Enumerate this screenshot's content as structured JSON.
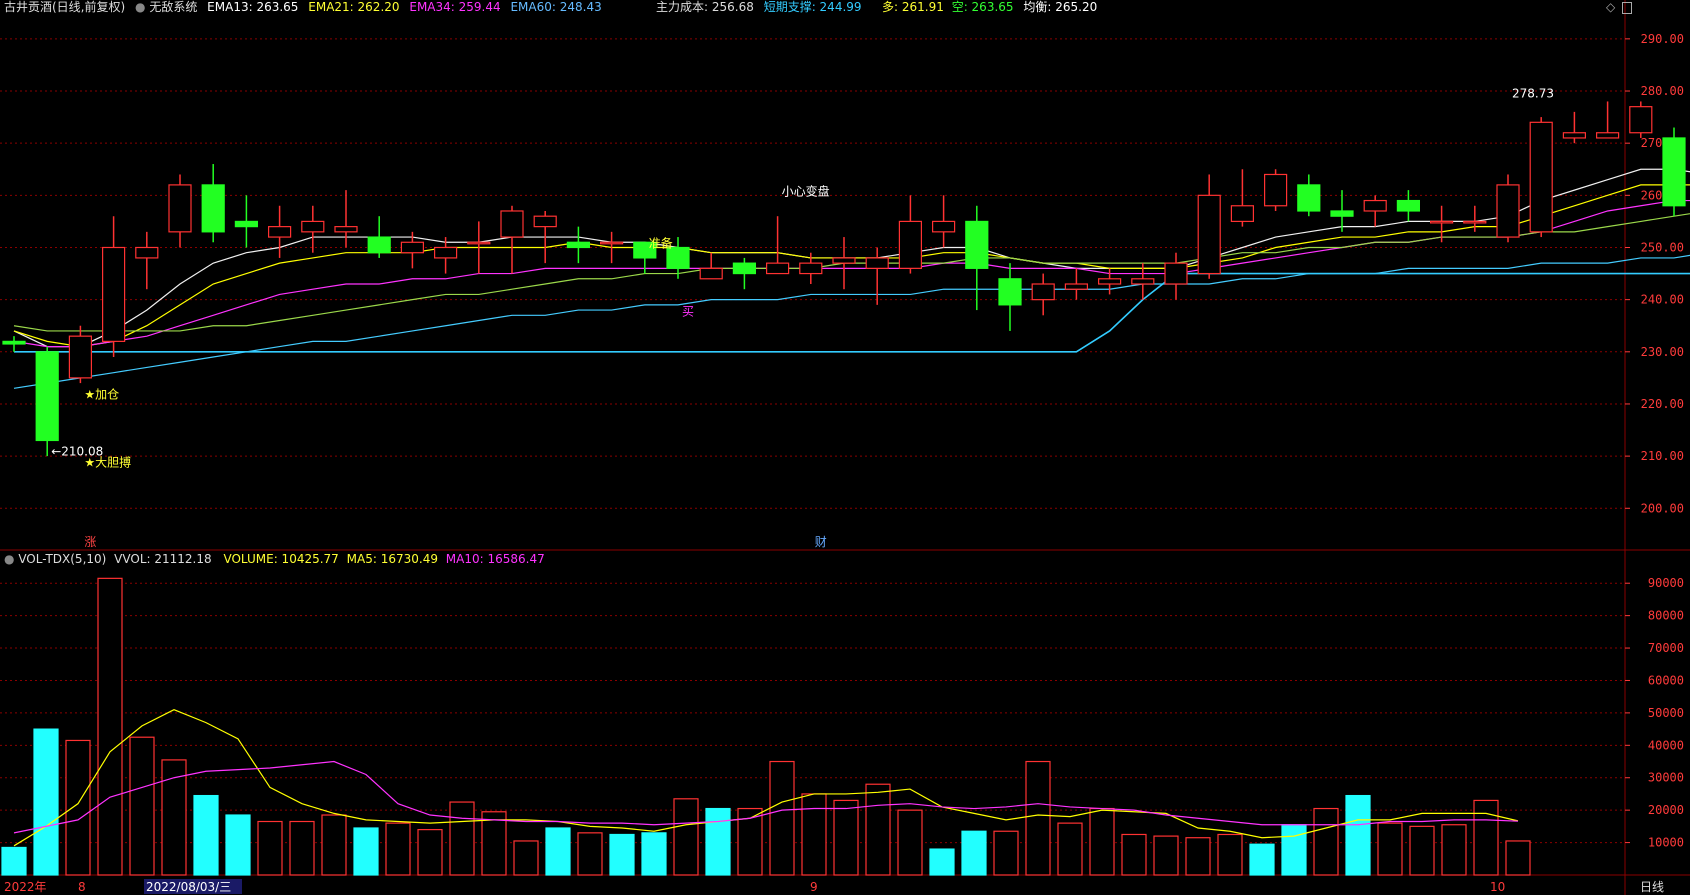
{
  "header": {
    "title": "古井贡酒(日线,前复权)",
    "system": "无敌系统",
    "ema13": "EMA13: 263.65",
    "ema21": "EMA21: 262.20",
    "ema34": "EMA34: 259.44",
    "ema60": "EMA60: 248.43",
    "main_cost": "主力成本: 256.68",
    "short_support": "短期支撑: 244.99",
    "duo": "多: 261.91",
    "kong": "空: 263.65",
    "balance": "均衡: 265.20",
    "window_icon": "◇",
    "window_button": ""
  },
  "volume_header": {
    "indicator": "VOL-TDX(5,10)",
    "vvol": "VVOL: 21112.18",
    "volume": "VOLUME: 10425.77",
    "ma5": "MA5: 16730.49",
    "ma10": "MA10: 16586.47"
  },
  "colors": {
    "up": "#ff3232",
    "down_price": "#22ff22",
    "down_vol": "#22ffff",
    "ema13": "#ffffff",
    "ema21": "#ffff00",
    "ema34": "#ff00ff",
    "ema60": "#33ccff",
    "grid": "#8a0000",
    "axis_text": "#ff3b3b"
  },
  "date_axis": {
    "labels": [
      "2022年",
      "8",
      "2022/08/03/三",
      "9",
      "10"
    ],
    "period": "日线"
  },
  "chart_data": [
    {
      "type": "candlestick",
      "title": "古井贡酒(日线,前复权)",
      "ylim": [
        192,
        294
      ],
      "yticks": [
        200,
        210,
        220,
        230,
        240,
        250,
        260,
        270,
        280,
        290
      ],
      "candles": [
        [
          232,
          233,
          230,
          231.5
        ],
        [
          230,
          231,
          210,
          213
        ],
        [
          225,
          235,
          224,
          233
        ],
        [
          232,
          256,
          229,
          250
        ],
        [
          248,
          253,
          242,
          250
        ],
        [
          253,
          264,
          250,
          262
        ],
        [
          262,
          266,
          251,
          253
        ],
        [
          255,
          260,
          250,
          254
        ],
        [
          252,
          258,
          248,
          254
        ],
        [
          253,
          258,
          249,
          255
        ],
        [
          253,
          261,
          250,
          254
        ],
        [
          252,
          256,
          248,
          249
        ],
        [
          249,
          253,
          246,
          251
        ],
        [
          248,
          252,
          245,
          250
        ],
        [
          251,
          255,
          245,
          251
        ],
        [
          252,
          258,
          245,
          257
        ],
        [
          254,
          257,
          247,
          256
        ],
        [
          251,
          254,
          247,
          250
        ],
        [
          251,
          253,
          247,
          251
        ],
        [
          251,
          251,
          245,
          248
        ],
        [
          250,
          252,
          244,
          246
        ],
        [
          244,
          249,
          244,
          246
        ],
        [
          247,
          248,
          242,
          245
        ],
        [
          245,
          256,
          245,
          247
        ],
        [
          245,
          249,
          243,
          247
        ],
        [
          247,
          252,
          242,
          248
        ],
        [
          246,
          250,
          239,
          248
        ],
        [
          246,
          260,
          245,
          255
        ],
        [
          253,
          260,
          250,
          255
        ],
        [
          255,
          258,
          238,
          246
        ],
        [
          244,
          247,
          234,
          239
        ],
        [
          240,
          245,
          237,
          243
        ],
        [
          242,
          246,
          240,
          243
        ],
        [
          243,
          246,
          241,
          244
        ],
        [
          243,
          247,
          240,
          244
        ],
        [
          243,
          249,
          240,
          247
        ],
        [
          245,
          264,
          244,
          260
        ],
        [
          255,
          265,
          254,
          258
        ],
        [
          258,
          265,
          257,
          264
        ],
        [
          262,
          264,
          256,
          257
        ],
        [
          257,
          261,
          253,
          256
        ],
        [
          257,
          260,
          254,
          259
        ],
        [
          259,
          261,
          255,
          257
        ],
        [
          255,
          258,
          251,
          255
        ],
        [
          255,
          258,
          253,
          255
        ],
        [
          252,
          264,
          251,
          262
        ],
        [
          253,
          275,
          252,
          274
        ],
        [
          271,
          276,
          270,
          272
        ],
        [
          271,
          278,
          271,
          272
        ],
        [
          272,
          278,
          271,
          277
        ],
        [
          271,
          273,
          256,
          258
        ],
        [
          258,
          260,
          250,
          259
        ]
      ],
      "series": [
        {
          "name": "EMA13",
          "values": [
            234,
            231,
            231,
            234,
            238,
            243,
            247,
            249,
            250,
            252,
            252,
            252,
            252,
            251,
            251,
            252,
            252,
            252,
            251,
            251,
            250,
            249,
            249,
            249,
            248,
            248,
            248,
            249,
            250,
            250,
            248,
            247,
            246,
            246,
            246,
            246,
            248,
            250,
            252,
            253,
            254,
            254,
            255,
            255,
            255,
            256,
            259,
            261,
            263,
            265,
            265,
            264
          ]
        },
        {
          "name": "EMA21",
          "values": [
            234,
            232,
            231,
            232,
            235,
            239,
            243,
            245,
            247,
            248,
            249,
            249,
            249,
            250,
            250,
            250,
            250,
            251,
            250,
            250,
            250,
            249,
            249,
            249,
            248,
            248,
            248,
            248,
            249,
            249,
            248,
            247,
            247,
            246,
            246,
            246,
            247,
            248,
            250,
            251,
            252,
            252,
            253,
            253,
            254,
            254,
            256,
            258,
            260,
            262,
            262,
            262
          ]
        },
        {
          "name": "EMA34",
          "values": [
            232,
            231,
            231,
            232,
            233,
            235,
            237,
            239,
            241,
            242,
            243,
            243,
            244,
            244,
            245,
            245,
            246,
            246,
            246,
            246,
            246,
            246,
            246,
            246,
            246,
            246,
            246,
            246,
            247,
            247,
            246,
            246,
            246,
            245,
            245,
            245,
            246,
            247,
            248,
            249,
            250,
            251,
            251,
            252,
            252,
            252,
            253,
            255,
            257,
            258,
            259,
            259
          ]
        },
        {
          "name": "EMA60",
          "values": [
            223,
            224,
            225,
            226,
            227,
            228,
            229,
            230,
            231,
            232,
            232,
            233,
            234,
            235,
            236,
            237,
            237,
            238,
            238,
            239,
            239,
            240,
            240,
            240,
            241,
            241,
            241,
            241,
            242,
            242,
            242,
            242,
            242,
            242,
            243,
            243,
            243,
            244,
            244,
            245,
            245,
            245,
            246,
            246,
            246,
            246,
            247,
            247,
            247,
            248,
            248,
            249
          ]
        },
        {
          "name": "短期支撑",
          "values": [
            230,
            230,
            230,
            230,
            230,
            230,
            230,
            230,
            230,
            230,
            230,
            230,
            230,
            230,
            230,
            230,
            230,
            230,
            230,
            230,
            230,
            230,
            230,
            230,
            230,
            230,
            230,
            230,
            230,
            230,
            230,
            230,
            230,
            234,
            240,
            245,
            245,
            245,
            245,
            245,
            245,
            245,
            245,
            245,
            245,
            245,
            245,
            245,
            245,
            245,
            245,
            245
          ]
        },
        {
          "name": "主力成本",
          "values": [
            235,
            234,
            234,
            234,
            234,
            234,
            235,
            235,
            236,
            237,
            238,
            239,
            240,
            241,
            241,
            242,
            243,
            244,
            244,
            245,
            245,
            246,
            246,
            246,
            246,
            247,
            247,
            247,
            247,
            248,
            248,
            247,
            247,
            247,
            247,
            247,
            248,
            249,
            249,
            250,
            250,
            251,
            251,
            252,
            252,
            252,
            253,
            253,
            254,
            255,
            256,
            257
          ]
        }
      ],
      "annotations": [
        {
          "text": "←210.08",
          "index": 1,
          "value": 210.08
        },
        {
          "text": "★大胆搏",
          "index": 2,
          "value": 208
        },
        {
          "text": "★加仓",
          "index": 2,
          "value": 221
        },
        {
          "text": "准备",
          "index": 19,
          "value": 250
        },
        {
          "text": "买",
          "index": 20,
          "value": 237
        },
        {
          "text": "小心变盘",
          "index": 23,
          "value": 260
        },
        {
          "text": "278.73",
          "index": 45,
          "value": 278.73
        },
        {
          "text": "涨",
          "index": 2,
          "value": 192
        },
        {
          "text": "财",
          "index": 24,
          "value": 192
        }
      ]
    },
    {
      "type": "bar",
      "title": "VOL-TDX(5,10)",
      "ylim": [
        0,
        95000
      ],
      "yticks": [
        10000,
        20000,
        30000,
        40000,
        50000,
        60000,
        70000,
        80000,
        90000
      ],
      "values": [
        8500,
        45000,
        41500,
        91500,
        42500,
        35500,
        24500,
        18500,
        16500,
        16500,
        18500,
        14500,
        16000,
        14000,
        22500,
        19500,
        10500,
        14500,
        13000,
        12500,
        13000,
        23500,
        20500,
        20500,
        35000,
        25000,
        23000,
        28000,
        20000,
        8000,
        13500,
        13500,
        35000,
        16000,
        20500,
        12500,
        12000,
        11500,
        12500,
        9500,
        15500,
        20500,
        24500,
        16000,
        15000,
        15500,
        23000,
        10500
      ],
      "series": [
        {
          "name": "MA5",
          "values": [
            9000,
            15000,
            22000,
            38000,
            46000,
            51000,
            47000,
            42000,
            27000,
            22000,
            19000,
            17000,
            16500,
            16000,
            16500,
            17000,
            17000,
            16500,
            15000,
            14500,
            13500,
            15500,
            16500,
            17500,
            22500,
            25000,
            25000,
            25500,
            26500,
            21000,
            19000,
            17000,
            18500,
            18000,
            20000,
            19500,
            19000,
            14500,
            13500,
            11500,
            12000,
            14500,
            17000,
            17000,
            19000,
            19000,
            19000,
            16700
          ]
        },
        {
          "name": "MA10",
          "values": [
            13000,
            15000,
            17000,
            24000,
            27000,
            30000,
            32000,
            32500,
            33000,
            34000,
            35000,
            31000,
            22000,
            18500,
            17500,
            17000,
            16500,
            16500,
            16000,
            16000,
            15500,
            16000,
            16500,
            17500,
            20000,
            20500,
            20500,
            21500,
            22000,
            21000,
            20500,
            21000,
            22000,
            21000,
            20500,
            20000,
            18500,
            17500,
            16500,
            15500,
            15500,
            15500,
            15500,
            16500,
            16500,
            17000,
            17000,
            16600
          ]
        }
      ]
    }
  ]
}
